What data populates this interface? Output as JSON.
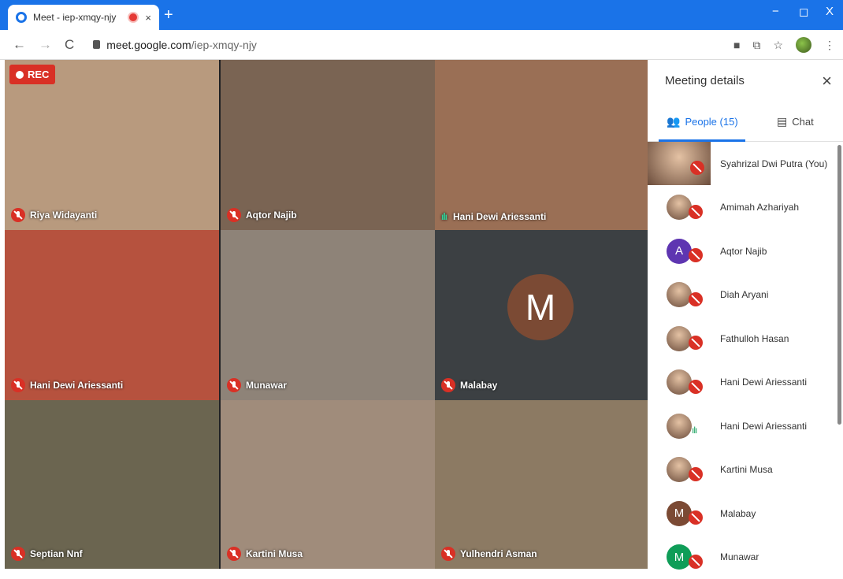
{
  "browser": {
    "tab_title": "Meet - iep-xmqy-njy",
    "tab_close": "×",
    "new_tab": "+",
    "window_controls": [
      "−",
      "◻",
      "X"
    ],
    "url_host": "meet.google.com",
    "url_path": "/iep-xmqy-njy",
    "icons": [
      "back-icon",
      "forward-icon",
      "reload-icon",
      "lock-icon",
      "camera-icon",
      "translate-icon",
      "star-icon",
      "profile-icon",
      "menu-icon"
    ]
  },
  "recording": {
    "label": "REC"
  },
  "tiles": [
    {
      "name": "Riya Widayanti",
      "muted": true,
      "bg": "#b89a7e"
    },
    {
      "name": "Aqtor Najib",
      "muted": true,
      "bg": "#7a6453"
    },
    {
      "name": "Hani Dewi Ariessanti",
      "muted": false,
      "speaking": true,
      "bg": "#9a6f55"
    },
    {
      "name": "Hani Dewi Ariessanti",
      "muted": true,
      "bg": "#b6523e"
    },
    {
      "name": "Munawar",
      "muted": true,
      "bg": "#8e8378"
    },
    {
      "name": "Malabay",
      "muted": true,
      "bg": "#3c4043",
      "initial": "M"
    },
    {
      "name": "Septian Nnf",
      "muted": true,
      "bg": "#6b6550"
    },
    {
      "name": "Kartini Musa",
      "muted": true,
      "bg": "#a08c7b"
    },
    {
      "name": "Yulhendri Asman",
      "muted": true,
      "bg": "#8c7a63"
    }
  ],
  "panel": {
    "title": "Meeting details",
    "close": "×",
    "tabs": [
      {
        "label": "People (15)",
        "active": true
      },
      {
        "label": "Chat",
        "active": false
      }
    ],
    "people": [
      {
        "name": "Syahrizal Dwi Putra (You)",
        "avatar": "photo",
        "muted": true,
        "self": true
      },
      {
        "name": "Amimah Azhariyah",
        "avatar": "photo",
        "muted": true
      },
      {
        "name": "Aqtor Najib",
        "avatar": "A",
        "color": "#5e35b1",
        "muted": true
      },
      {
        "name": "Diah Aryani",
        "avatar": "photo",
        "muted": true
      },
      {
        "name": "Fathulloh Hasan",
        "avatar": "photo",
        "muted": true
      },
      {
        "name": "Hani Dewi Ariessanti",
        "avatar": "photo",
        "muted": true
      },
      {
        "name": "Hani Dewi Ariessanti",
        "avatar": "photo",
        "muted": false,
        "speaking": true
      },
      {
        "name": "Kartini Musa",
        "avatar": "photo",
        "muted": true
      },
      {
        "name": "Malabay",
        "avatar": "M",
        "color": "#7b4a34",
        "muted": true
      },
      {
        "name": "Munawar",
        "avatar": "M",
        "color": "#0f9d58",
        "muted": true
      }
    ]
  }
}
